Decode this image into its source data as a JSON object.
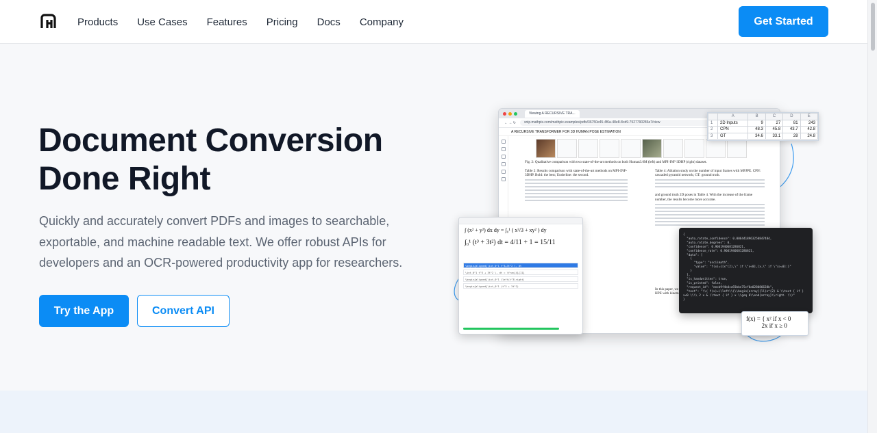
{
  "nav": {
    "links": [
      "Products",
      "Use Cases",
      "Features",
      "Pricing",
      "Docs",
      "Company"
    ],
    "cta": "Get Started"
  },
  "hero": {
    "title_line1": "Document Conversion",
    "title_line2": "Done Right",
    "subtitle": "Quickly and accurately convert PDFs and images to searchable, exportable, and machine readable text. We offer robust APIs for developers and an OCR-powered productivity app for researchers.",
    "primary_button": "Try the App",
    "secondary_button": "Convert API"
  },
  "illustration": {
    "tab_title": "Viewing A RECURSIVE TRA...",
    "url": "snip.mathpix.com/mathpix-examples/pdfs/36750e45-4f6a-48e8-8cd9-7527790286e7/view",
    "doc_title": "A RECURSIVE TRANSFORMER FOR 3D HUMAN POSE ESTIMATION",
    "fig_caption": "Fig. 2: Qualitative comparison with two state-of-the-art methods on both Human3.6M (left) and MPI-INF-3DHP (right) dataset.",
    "table2_caption": "Table 2: Results comparison with state-of-the-art methods on MPI-INF-3DHP. Bold: the best; Underline: the second.",
    "table4_caption": "Table 4: Ablation study on the number of input frames with MPJPE. CPN: cascaded pyramid network; GT: ground truth.",
    "para1": "and ground truth 2D poses in Table 4. With the increase of the frame number, the results become more accurate.",
    "para2": "In this paper, we propose EvoPose, a novel recursive transformer for 3D HPE with kinematic structure priors.",
    "sheet": {
      "cols": [
        "A",
        "B",
        "C",
        "D",
        "E"
      ],
      "rows": [
        [
          "2D Inputs",
          "9",
          "27",
          "81",
          "243"
        ],
        [
          "CPN",
          "48.3",
          "45.8",
          "43.7",
          "42.8"
        ],
        [
          "GT",
          "34.6",
          "33.1",
          "28",
          "24.8"
        ]
      ]
    },
    "json_lines": [
      "{",
      "  \"auto_rotate_confidence\": 0.0064418963250847484,",
      "  \"auto_rotate_degrees\": 0,",
      "  \"confidence\": 0.9041940681286821,",
      "  \"confidence_rate\": 0.9041940681286821,",
      "  \"data\": [",
      "    {",
      "      \"type\": \"asciimath\",",
      "      \"value\": \"f(x)={[x^(2),\\\" if \\\"x<0],[x,\\\" if \\\"x>=0]:}\"",
      "    }",
      "  ],",
      "  \"is_handwritten\": true,",
      "  \"is_printed\": false,",
      "  \"request_id\": \"eecb9f4b4ca93bbe75cf0a028086638b\",",
      "  \"text\": \"\\\\( f(x)=\\\\left\\\\{\\\\begin{array}{ll}x^{2} & \\\\text { if }",
      "x<0 \\\\\\\\ 2 x & \\\\text { if } x \\\\geq 0\\\\end{array}\\\\right. \\\\)\"",
      "}"
    ]
  },
  "colors": {
    "accent": "#0b8cf5",
    "title": "#111827",
    "body": "#5b6472"
  }
}
